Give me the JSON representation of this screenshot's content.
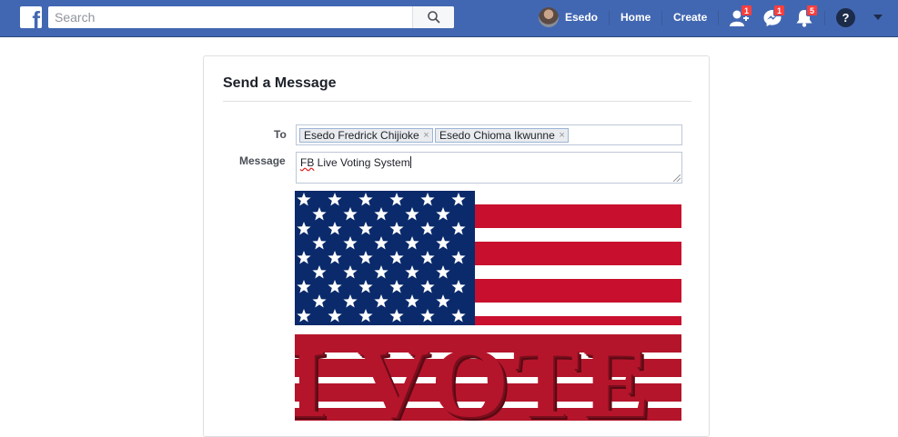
{
  "topbar": {
    "search_placeholder": "Search",
    "user_name": "Esedo",
    "home_label": "Home",
    "create_label": "Create",
    "friend_requests_count": "1",
    "messages_count": "1",
    "notifications_count": "5",
    "help_label": "?",
    "brand_color": "#4267b2"
  },
  "dialog": {
    "title": "Send a Message",
    "to_label": "To",
    "message_label": "Message",
    "recipients": [
      "Esedo Fredrick Chijioke",
      "Esedo Chioma Ikwunne"
    ],
    "message_prefix": "FB",
    "message_rest": " Live Voting System",
    "image_text": "I VOTE"
  }
}
